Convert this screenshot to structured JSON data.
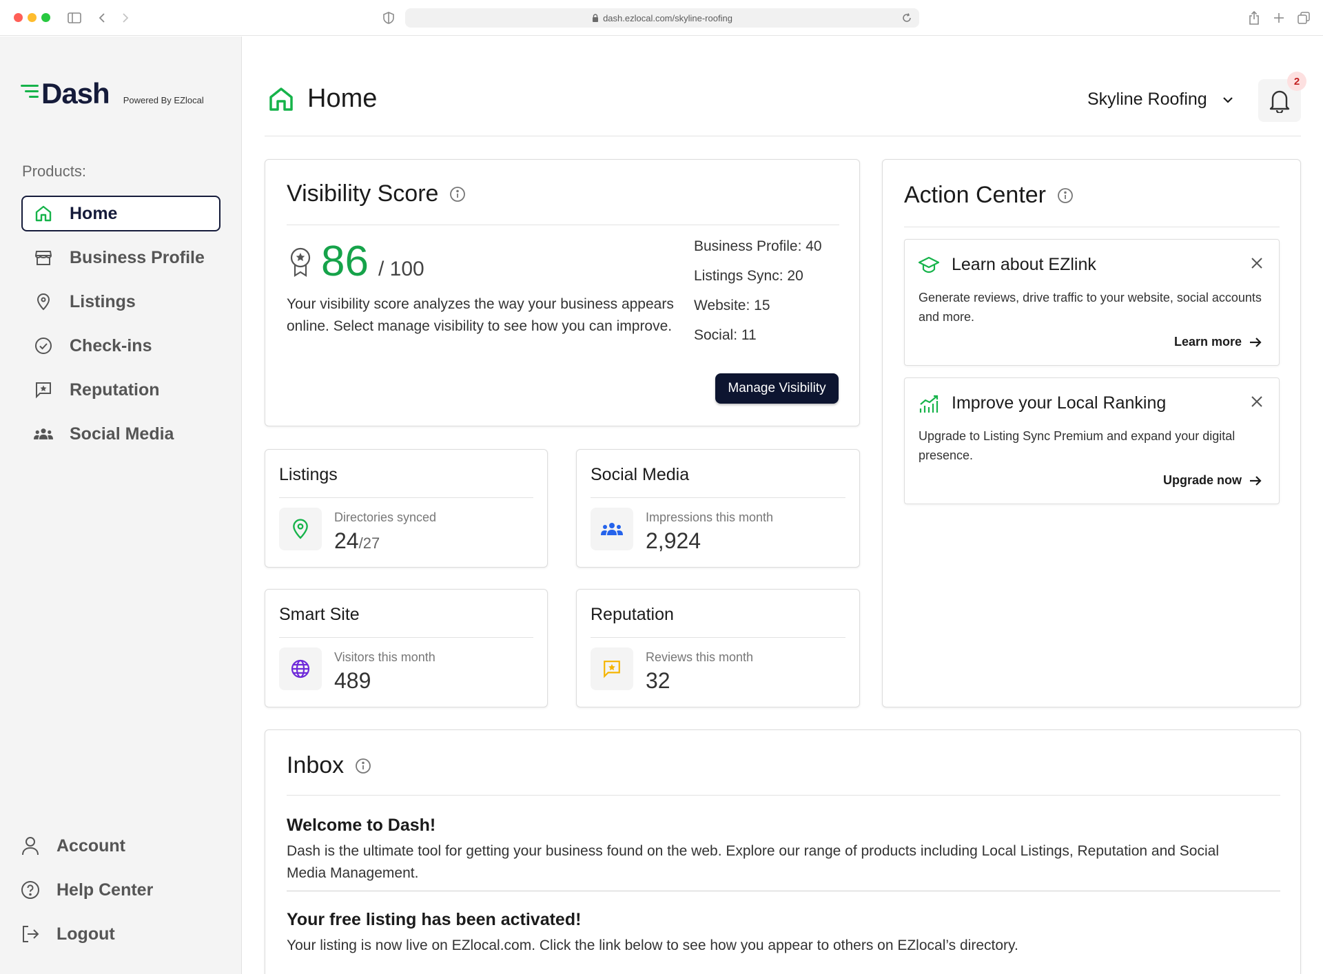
{
  "browser": {
    "url": "dash.ezlocal.com/skyline-roofing"
  },
  "sidebar": {
    "logo_text": "Dash",
    "logo_sub": "Powered By EZlocal",
    "products_label": "Products:",
    "items": [
      {
        "label": "Home",
        "icon": "home-icon",
        "active": true
      },
      {
        "label": "Business Profile",
        "icon": "store-icon"
      },
      {
        "label": "Listings",
        "icon": "map-pin-icon"
      },
      {
        "label": "Check-ins",
        "icon": "check-circle-icon"
      },
      {
        "label": "Reputation",
        "icon": "star-message-icon"
      },
      {
        "label": "Social Media",
        "icon": "users-icon"
      }
    ],
    "bottom_items": [
      {
        "label": "Account",
        "icon": "user-icon"
      },
      {
        "label": "Help Center",
        "icon": "help-circle-icon"
      },
      {
        "label": "Logout",
        "icon": "logout-icon"
      }
    ]
  },
  "header": {
    "title": "Home",
    "business_name": "Skyline Roofing",
    "notification_count": "2"
  },
  "visibility": {
    "title": "Visibility Score",
    "score": "86",
    "out_of": "/ 100",
    "description": "Your visibility score analyzes the way your business appears online. Select manage visibility to see how you can improve.",
    "breakdown": [
      "Business Profile: 40",
      "Listings Sync: 20",
      "Website: 15",
      "Social: 11"
    ],
    "button_label": "Manage Visibility"
  },
  "stats": {
    "listings": {
      "title": "Listings",
      "label": "Directories synced",
      "value": "24",
      "total": "/27",
      "icon": "map-pin-icon",
      "color": "#16b34a"
    },
    "social": {
      "title": "Social Media",
      "label": "Impressions this month",
      "value": "2,924",
      "icon": "users-icon",
      "color": "#2563eb"
    },
    "smart_site": {
      "title": "Smart Site",
      "label": "Visitors this month",
      "value": "489",
      "icon": "globe-icon",
      "color": "#6d28d9"
    },
    "reputation": {
      "title": "Reputation",
      "label": "Reviews this month",
      "value": "32",
      "icon": "star-message-icon",
      "color": "#f5b400"
    }
  },
  "action_center": {
    "title": "Action Center",
    "tips": [
      {
        "title": "Learn about EZlink",
        "body": "Generate reviews, drive traffic to your website, social accounts and more.",
        "link": "Learn more",
        "icon": "graduation-cap-icon"
      },
      {
        "title": "Improve your Local Ranking",
        "body": "Upgrade to Listing Sync Premium and expand your digital presence.",
        "link": "Upgrade now",
        "icon": "chart-up-icon"
      }
    ]
  },
  "inbox": {
    "title": "Inbox",
    "messages": [
      {
        "heading": "Welcome to Dash!",
        "body": "Dash is the ultimate tool for getting your business found on the web. Explore our range of products including Local Listings, Reputation and Social Media Management."
      },
      {
        "heading": "Your free listing has been activated!",
        "body": "Your listing is now live on EZlocal.com. Click the link below to see how you appear to others on EZlocal’s directory."
      }
    ]
  },
  "colors": {
    "accent": "#16b34a",
    "navy": "#0d1530",
    "badge_bg": "#fde0e0",
    "badge_text": "#c21f1f"
  }
}
